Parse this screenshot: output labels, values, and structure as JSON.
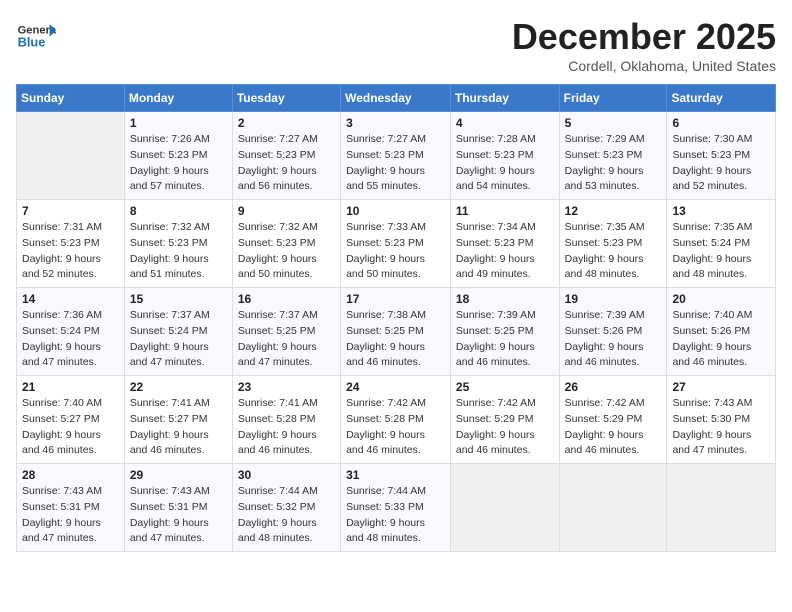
{
  "logo": {
    "general": "General",
    "blue": "Blue"
  },
  "title": "December 2025",
  "location": "Cordell, Oklahoma, United States",
  "days_of_week": [
    "Sunday",
    "Monday",
    "Tuesday",
    "Wednesday",
    "Thursday",
    "Friday",
    "Saturday"
  ],
  "weeks": [
    [
      {
        "num": "",
        "sunrise": "",
        "sunset": "",
        "daylight": ""
      },
      {
        "num": "1",
        "sunrise": "Sunrise: 7:26 AM",
        "sunset": "Sunset: 5:23 PM",
        "daylight": "Daylight: 9 hours and 57 minutes."
      },
      {
        "num": "2",
        "sunrise": "Sunrise: 7:27 AM",
        "sunset": "Sunset: 5:23 PM",
        "daylight": "Daylight: 9 hours and 56 minutes."
      },
      {
        "num": "3",
        "sunrise": "Sunrise: 7:27 AM",
        "sunset": "Sunset: 5:23 PM",
        "daylight": "Daylight: 9 hours and 55 minutes."
      },
      {
        "num": "4",
        "sunrise": "Sunrise: 7:28 AM",
        "sunset": "Sunset: 5:23 PM",
        "daylight": "Daylight: 9 hours and 54 minutes."
      },
      {
        "num": "5",
        "sunrise": "Sunrise: 7:29 AM",
        "sunset": "Sunset: 5:23 PM",
        "daylight": "Daylight: 9 hours and 53 minutes."
      },
      {
        "num": "6",
        "sunrise": "Sunrise: 7:30 AM",
        "sunset": "Sunset: 5:23 PM",
        "daylight": "Daylight: 9 hours and 52 minutes."
      }
    ],
    [
      {
        "num": "7",
        "sunrise": "Sunrise: 7:31 AM",
        "sunset": "Sunset: 5:23 PM",
        "daylight": "Daylight: 9 hours and 52 minutes."
      },
      {
        "num": "8",
        "sunrise": "Sunrise: 7:32 AM",
        "sunset": "Sunset: 5:23 PM",
        "daylight": "Daylight: 9 hours and 51 minutes."
      },
      {
        "num": "9",
        "sunrise": "Sunrise: 7:32 AM",
        "sunset": "Sunset: 5:23 PM",
        "daylight": "Daylight: 9 hours and 50 minutes."
      },
      {
        "num": "10",
        "sunrise": "Sunrise: 7:33 AM",
        "sunset": "Sunset: 5:23 PM",
        "daylight": "Daylight: 9 hours and 50 minutes."
      },
      {
        "num": "11",
        "sunrise": "Sunrise: 7:34 AM",
        "sunset": "Sunset: 5:23 PM",
        "daylight": "Daylight: 9 hours and 49 minutes."
      },
      {
        "num": "12",
        "sunrise": "Sunrise: 7:35 AM",
        "sunset": "Sunset: 5:23 PM",
        "daylight": "Daylight: 9 hours and 48 minutes."
      },
      {
        "num": "13",
        "sunrise": "Sunrise: 7:35 AM",
        "sunset": "Sunset: 5:24 PM",
        "daylight": "Daylight: 9 hours and 48 minutes."
      }
    ],
    [
      {
        "num": "14",
        "sunrise": "Sunrise: 7:36 AM",
        "sunset": "Sunset: 5:24 PM",
        "daylight": "Daylight: 9 hours and 47 minutes."
      },
      {
        "num": "15",
        "sunrise": "Sunrise: 7:37 AM",
        "sunset": "Sunset: 5:24 PM",
        "daylight": "Daylight: 9 hours and 47 minutes."
      },
      {
        "num": "16",
        "sunrise": "Sunrise: 7:37 AM",
        "sunset": "Sunset: 5:25 PM",
        "daylight": "Daylight: 9 hours and 47 minutes."
      },
      {
        "num": "17",
        "sunrise": "Sunrise: 7:38 AM",
        "sunset": "Sunset: 5:25 PM",
        "daylight": "Daylight: 9 hours and 46 minutes."
      },
      {
        "num": "18",
        "sunrise": "Sunrise: 7:39 AM",
        "sunset": "Sunset: 5:25 PM",
        "daylight": "Daylight: 9 hours and 46 minutes."
      },
      {
        "num": "19",
        "sunrise": "Sunrise: 7:39 AM",
        "sunset": "Sunset: 5:26 PM",
        "daylight": "Daylight: 9 hours and 46 minutes."
      },
      {
        "num": "20",
        "sunrise": "Sunrise: 7:40 AM",
        "sunset": "Sunset: 5:26 PM",
        "daylight": "Daylight: 9 hours and 46 minutes."
      }
    ],
    [
      {
        "num": "21",
        "sunrise": "Sunrise: 7:40 AM",
        "sunset": "Sunset: 5:27 PM",
        "daylight": "Daylight: 9 hours and 46 minutes."
      },
      {
        "num": "22",
        "sunrise": "Sunrise: 7:41 AM",
        "sunset": "Sunset: 5:27 PM",
        "daylight": "Daylight: 9 hours and 46 minutes."
      },
      {
        "num": "23",
        "sunrise": "Sunrise: 7:41 AM",
        "sunset": "Sunset: 5:28 PM",
        "daylight": "Daylight: 9 hours and 46 minutes."
      },
      {
        "num": "24",
        "sunrise": "Sunrise: 7:42 AM",
        "sunset": "Sunset: 5:28 PM",
        "daylight": "Daylight: 9 hours and 46 minutes."
      },
      {
        "num": "25",
        "sunrise": "Sunrise: 7:42 AM",
        "sunset": "Sunset: 5:29 PM",
        "daylight": "Daylight: 9 hours and 46 minutes."
      },
      {
        "num": "26",
        "sunrise": "Sunrise: 7:42 AM",
        "sunset": "Sunset: 5:29 PM",
        "daylight": "Daylight: 9 hours and 46 minutes."
      },
      {
        "num": "27",
        "sunrise": "Sunrise: 7:43 AM",
        "sunset": "Sunset: 5:30 PM",
        "daylight": "Daylight: 9 hours and 47 minutes."
      }
    ],
    [
      {
        "num": "28",
        "sunrise": "Sunrise: 7:43 AM",
        "sunset": "Sunset: 5:31 PM",
        "daylight": "Daylight: 9 hours and 47 minutes."
      },
      {
        "num": "29",
        "sunrise": "Sunrise: 7:43 AM",
        "sunset": "Sunset: 5:31 PM",
        "daylight": "Daylight: 9 hours and 47 minutes."
      },
      {
        "num": "30",
        "sunrise": "Sunrise: 7:44 AM",
        "sunset": "Sunset: 5:32 PM",
        "daylight": "Daylight: 9 hours and 48 minutes."
      },
      {
        "num": "31",
        "sunrise": "Sunrise: 7:44 AM",
        "sunset": "Sunset: 5:33 PM",
        "daylight": "Daylight: 9 hours and 48 minutes."
      },
      {
        "num": "",
        "sunrise": "",
        "sunset": "",
        "daylight": ""
      },
      {
        "num": "",
        "sunrise": "",
        "sunset": "",
        "daylight": ""
      },
      {
        "num": "",
        "sunrise": "",
        "sunset": "",
        "daylight": ""
      }
    ]
  ]
}
